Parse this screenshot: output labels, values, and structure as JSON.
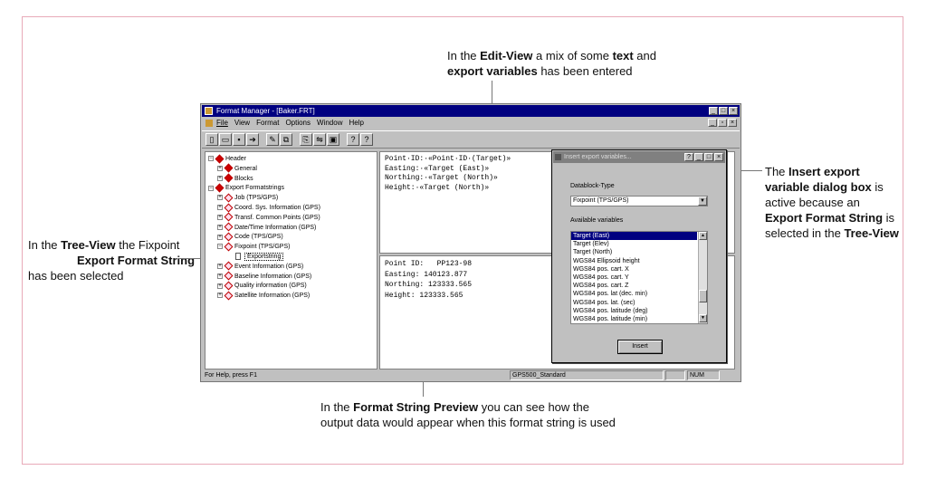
{
  "annotations": {
    "edit_view": {
      "parts": [
        "In the ",
        "Edit-View",
        " a mix of some ",
        "text",
        " and ",
        "export variables",
        " has been entered"
      ]
    },
    "tree_view": {
      "parts": [
        "In the ",
        "Tree-View",
        " the Fixpoint ",
        "Export Format String",
        " has been selected"
      ]
    },
    "dialog_box": {
      "parts": [
        "The ",
        "Insert export variable dialog box",
        " is active because an ",
        "Export Format String",
        " is selected in the ",
        "Tree-View"
      ]
    },
    "preview": {
      "parts": [
        "In the ",
        "Format String Preview",
        " you can see how the output data would appear when this format string is used"
      ]
    }
  },
  "window": {
    "title": "Format Manager - [Baker.FRT]",
    "menu": [
      "File",
      "View",
      "Format",
      "Options",
      "Window",
      "Help"
    ],
    "toolbar_icons": [
      "new-icon",
      "open-icon",
      "save-icon",
      "export-icon",
      "format-icon",
      "block-icon",
      "copy-icon",
      "paste-icon",
      "properties-icon",
      "help-icon",
      "context-help-icon"
    ],
    "toolbar_glyphs": [
      "▯",
      "▭",
      "▪",
      "➔",
      "✎",
      "⧉",
      "⎘",
      "⇋",
      "▣",
      "?",
      "?"
    ]
  },
  "tree": {
    "nodes": [
      {
        "label": "Header",
        "level": 0,
        "pm": "−",
        "icon": "filled"
      },
      {
        "label": "General",
        "level": 1,
        "pm": "+",
        "icon": "filled"
      },
      {
        "label": "Blocks",
        "level": 1,
        "pm": "+",
        "icon": "filled"
      },
      {
        "label": "Export Formatstrings",
        "level": 0,
        "pm": "−",
        "icon": "filled"
      },
      {
        "label": "Job (TPS/GPS)",
        "level": 1,
        "pm": "+",
        "icon": "hollow"
      },
      {
        "label": "Coord. Sys. Information (GPS)",
        "level": 1,
        "pm": "+",
        "icon": "hollow"
      },
      {
        "label": "Transf. Common Points (GPS)",
        "level": 1,
        "pm": "+",
        "icon": "hollow"
      },
      {
        "label": "Date/Time Information (GPS)",
        "level": 1,
        "pm": "+",
        "icon": "hollow"
      },
      {
        "label": "Code (TPS/GPS)",
        "level": 1,
        "pm": "+",
        "icon": "hollow"
      },
      {
        "label": "Fixpoint (TPS/GPS)",
        "level": 1,
        "pm": "−",
        "icon": "hollow"
      },
      {
        "label": "Exportstring",
        "level": 2,
        "pm": "",
        "icon": "doc"
      },
      {
        "label": "Event Information (GPS)",
        "level": 1,
        "pm": "+",
        "icon": "hollow"
      },
      {
        "label": "Baseline Information (GPS)",
        "level": 1,
        "pm": "+",
        "icon": "hollow"
      },
      {
        "label": "Quality information (GPS)",
        "level": 1,
        "pm": "+",
        "icon": "hollow"
      },
      {
        "label": "Satellite Information (GPS)",
        "level": 1,
        "pm": "+",
        "icon": "hollow"
      }
    ]
  },
  "edit_view": {
    "lines": [
      "Point·ID:·«Point·ID·(Target)»",
      "Easting:·«Target (East)»",
      "Northing:·«Target (North)»",
      "Height:·«Target (North)»"
    ]
  },
  "preview_view": {
    "lines": [
      "Point ID:   PP123-98",
      "Easting: 140123.877",
      "Northing: 123333.565",
      "Height: 123333.565"
    ]
  },
  "status_bar": {
    "help_text": "For Help, press F1",
    "profile": "GPS500_Standard",
    "num": "NUM"
  },
  "dialog": {
    "title": "Insert export variables...",
    "datablock_label": "Datablock-Type",
    "datablock_value": "Fixpoint (TPS/GPS)",
    "available_label": "Available variables",
    "variables": [
      "Target (East)",
      "Target (Elev)",
      "Target (North)",
      "WGS84 Ellipsoid height",
      "WGS84 pos. cart. X",
      "WGS84 pos. cart. Y",
      "WGS84 pos. cart. Z",
      "WGS84 pos. lat (dec. min)",
      "WGS84 pos. lat. (sec)",
      "WGS84 pos. latitude (deg)",
      "WGS84 pos. latitude (min)"
    ],
    "selected_variable": "Target (East)",
    "insert_label": "Insert"
  }
}
